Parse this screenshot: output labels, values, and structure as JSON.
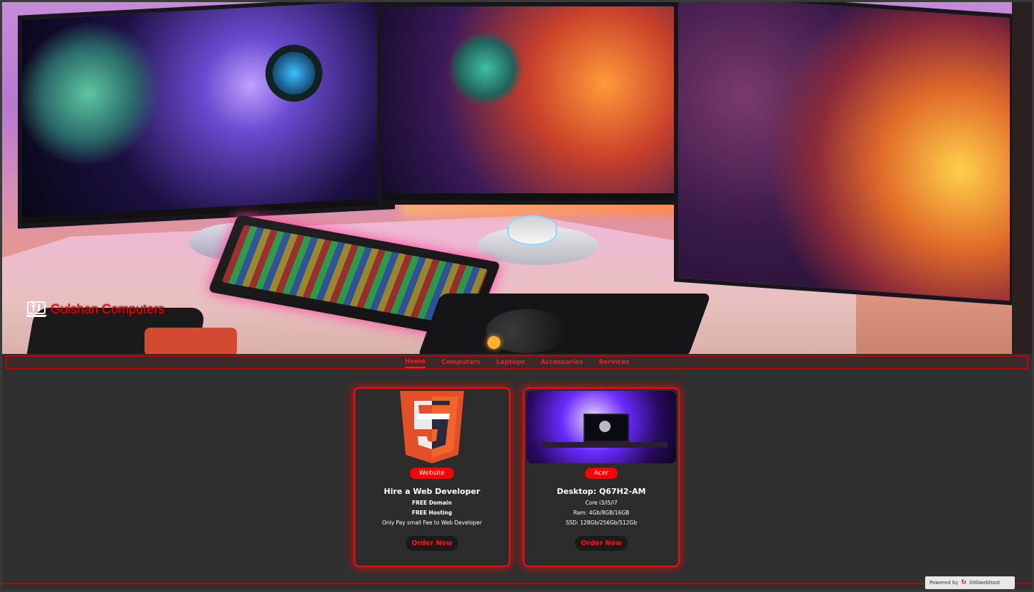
{
  "brand": {
    "name": "Gulshan Computers",
    "icon": "laptop-tools-icon"
  },
  "nav": {
    "items": [
      "Home",
      "Computers",
      "Laptops",
      "Accessories",
      "Services"
    ],
    "active": "Home"
  },
  "cards": [
    {
      "badge": "Website",
      "title": "Hire a Web Developer",
      "lines": [
        "FREE Domain",
        "FREE Hosting",
        "Only Pay small Fee to Web Developer"
      ],
      "button": "Order Now",
      "image": "html5-logo"
    },
    {
      "badge": "Acer",
      "title": "Desktop: Q67H2-AM",
      "lines": [
        "Core i3/i5/i7",
        "Ram: 4Gb/8GB/16GB",
        "SSD: 128Gb/256Gb/512Gb"
      ],
      "button": "Order Now",
      "image": "desktop-setup-photo"
    }
  ],
  "footer": {
    "powered_by": "Powered by",
    "host": "000webhost"
  },
  "colors": {
    "accent": "#ff0000",
    "background": "#303030"
  }
}
